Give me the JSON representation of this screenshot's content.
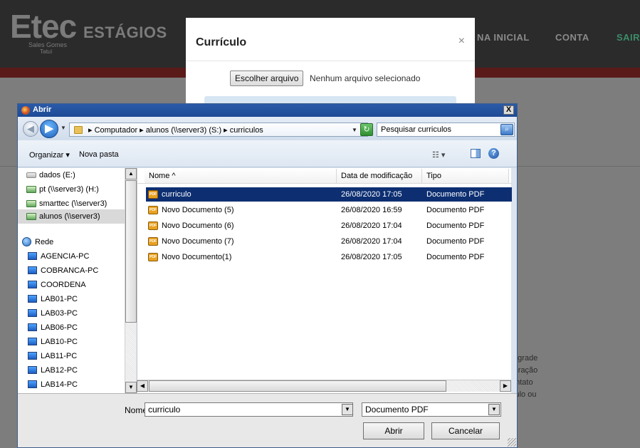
{
  "site": {
    "logo_big": "Etec",
    "logo_word": "ESTÁGIOS",
    "logo_sub1": "Sales Gomes",
    "logo_sub2": "Tatuí",
    "nav": [
      "NA INICIAL",
      "CONTA",
      "SAIR"
    ],
    "side_lines": [
      "a grade",
      "reração",
      "ontato",
      "culo ou"
    ]
  },
  "modal": {
    "title": "Currículo",
    "close": "×",
    "file_button": "Escolher arquivo",
    "file_status": "Nenhum arquivo selecionado"
  },
  "dialog": {
    "title": "Abrir",
    "close": "X",
    "address": "▸ Computador ▸ alunos (\\\\server3) (S:) ▸ curriculos",
    "search_placeholder": "Pesquisar curriculos",
    "toolbar": {
      "organize": "Organizar ▾",
      "new_folder": "Nova pasta",
      "views": "☷ ▾"
    },
    "nav_items": [
      {
        "label": "dados (E:)",
        "icon": "drive"
      },
      {
        "label": "pt (\\\\server3) (H:)",
        "icon": "net"
      },
      {
        "label": "smarttec (\\\\server3)",
        "icon": "net"
      },
      {
        "label": "alunos (\\\\server3)",
        "icon": "net",
        "selected": true
      },
      {
        "label": "",
        "icon": "none"
      },
      {
        "label": "Rede",
        "icon": "globe"
      },
      {
        "label": "AGENCIA-PC",
        "icon": "pc"
      },
      {
        "label": "COBRANCA-PC",
        "icon": "pc"
      },
      {
        "label": "COORDENA",
        "icon": "pc"
      },
      {
        "label": "LAB01-PC",
        "icon": "pc"
      },
      {
        "label": "LAB03-PC",
        "icon": "pc"
      },
      {
        "label": "LAB06-PC",
        "icon": "pc"
      },
      {
        "label": "LAB10-PC",
        "icon": "pc"
      },
      {
        "label": "LAB11-PC",
        "icon": "pc"
      },
      {
        "label": "LAB12-PC",
        "icon": "pc"
      },
      {
        "label": "LAB14-PC",
        "icon": "pc"
      }
    ],
    "columns": {
      "name": "Nome",
      "date": "Data de modificação",
      "type": "Tipo"
    },
    "files": [
      {
        "name": "curriculo",
        "date": "26/08/2020 17:05",
        "type": "Documento PDF",
        "selected": true
      },
      {
        "name": "Novo Documento (5)",
        "date": "26/08/2020 16:59",
        "type": "Documento PDF"
      },
      {
        "name": "Novo Documento (6)",
        "date": "26/08/2020 17:04",
        "type": "Documento PDF"
      },
      {
        "name": "Novo Documento (7)",
        "date": "26/08/2020 17:04",
        "type": "Documento PDF"
      },
      {
        "name": "Novo Documento(1)",
        "date": "26/08/2020 17:05",
        "type": "Documento PDF"
      }
    ],
    "name_label": "Nome:",
    "name_value": "curriculo",
    "file_type": "Documento PDF",
    "open_button": "Abrir",
    "cancel_button": "Cancelar"
  },
  "colors": {
    "selection": "#0d2f72",
    "titlebar": "#1d4a95",
    "site_header": "#2b2b2b",
    "nav_active": "#3c8d6a"
  }
}
